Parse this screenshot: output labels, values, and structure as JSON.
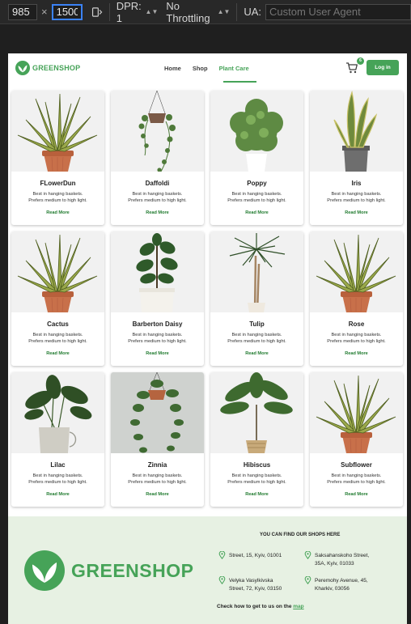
{
  "devtools": {
    "width": "985",
    "height": "1500",
    "dpr": "DPR: 1",
    "throttling": "No Throttling",
    "ua_label": "UA:",
    "ua_placeholder": "Custom User Agent"
  },
  "header": {
    "brand": "GREENSHOP",
    "menu": [
      "Home",
      "Shop",
      "Plant Care"
    ],
    "active_menu": "Plant Care",
    "cart_count": "6",
    "login_label": "Log in"
  },
  "products": [
    {
      "name": "FLowerDun",
      "desc1": "Best in hanging baskets.",
      "desc2": "Prefers medium to high light.",
      "more": "Read More",
      "plant": "snake-in-pot"
    },
    {
      "name": "Daffoldi",
      "desc1": "Best in hanging baskets.",
      "desc2": "Prefers medium to high light.",
      "more": "Read More",
      "plant": "hanging"
    },
    {
      "name": "Poppy",
      "desc1": "Best in hanging baskets.",
      "desc2": "Prefers medium to high light.",
      "more": "Read More",
      "plant": "bush"
    },
    {
      "name": "Iris",
      "desc1": "Best in hanging baskets.",
      "desc2": "Prefers medium to high light.",
      "more": "Read More",
      "plant": "sansevieria"
    },
    {
      "name": "Cactus",
      "desc1": "Best in hanging baskets.",
      "desc2": "Prefers medium to high light.",
      "more": "Read More",
      "plant": "snake-in-pot"
    },
    {
      "name": "Barberton Daisy",
      "desc1": "Best in hanging baskets.",
      "desc2": "Prefers medium to high light.",
      "more": "Read More",
      "plant": "fiddle"
    },
    {
      "name": "Tulip",
      "desc1": "Best in hanging baskets.",
      "desc2": "Prefers medium to high light.",
      "more": "Read More",
      "plant": "dracaena"
    },
    {
      "name": "Rose",
      "desc1": "Best in hanging baskets.",
      "desc2": "Prefers medium to high light.",
      "more": "Read More",
      "plant": "snake-in-pot"
    },
    {
      "name": "Lilac",
      "desc1": "Best in hanging baskets.",
      "desc2": "Prefers medium to high light.",
      "more": "Read More",
      "plant": "broadleaf"
    },
    {
      "name": "Zinnia",
      "desc1": "Best in hanging baskets.",
      "desc2": "Prefers medium to high light.",
      "more": "Read More",
      "plant": "hanging-dark"
    },
    {
      "name": "Hibiscus",
      "desc1": "Best in hanging baskets.",
      "desc2": "Prefers medium to high light.",
      "more": "Read More",
      "plant": "palm"
    },
    {
      "name": "Subflower",
      "desc1": "Best in hanging baskets.",
      "desc2": "Prefers medium to high light.",
      "more": "Read More",
      "plant": "snake-in-pot"
    }
  ],
  "footer": {
    "brand": "GREENSHOP",
    "heading": "YOU CAN FIND OUR SHOPS HERE",
    "addresses": [
      {
        "line1": "Street, 15, Kyiv, 01001",
        "line2": ""
      },
      {
        "line1": "Saksahanskoho Street,",
        "line2": "35A, Kyiv, 01033"
      },
      {
        "line1": "Velyka Vasylkivska",
        "line2": "Street, 72, Kyiv, 03150"
      },
      {
        "line1": "Peremohy Avenue, 45,",
        "line2": "Kharkiv, 03056"
      }
    ],
    "map_text": "Check how to get to us on the",
    "map_link": "map"
  },
  "colors": {
    "brand_green": "#46a358",
    "read_more": "#1f7a2e",
    "footer_bg": "#e7f1e3",
    "pot_terracotta": "#c8704a"
  }
}
